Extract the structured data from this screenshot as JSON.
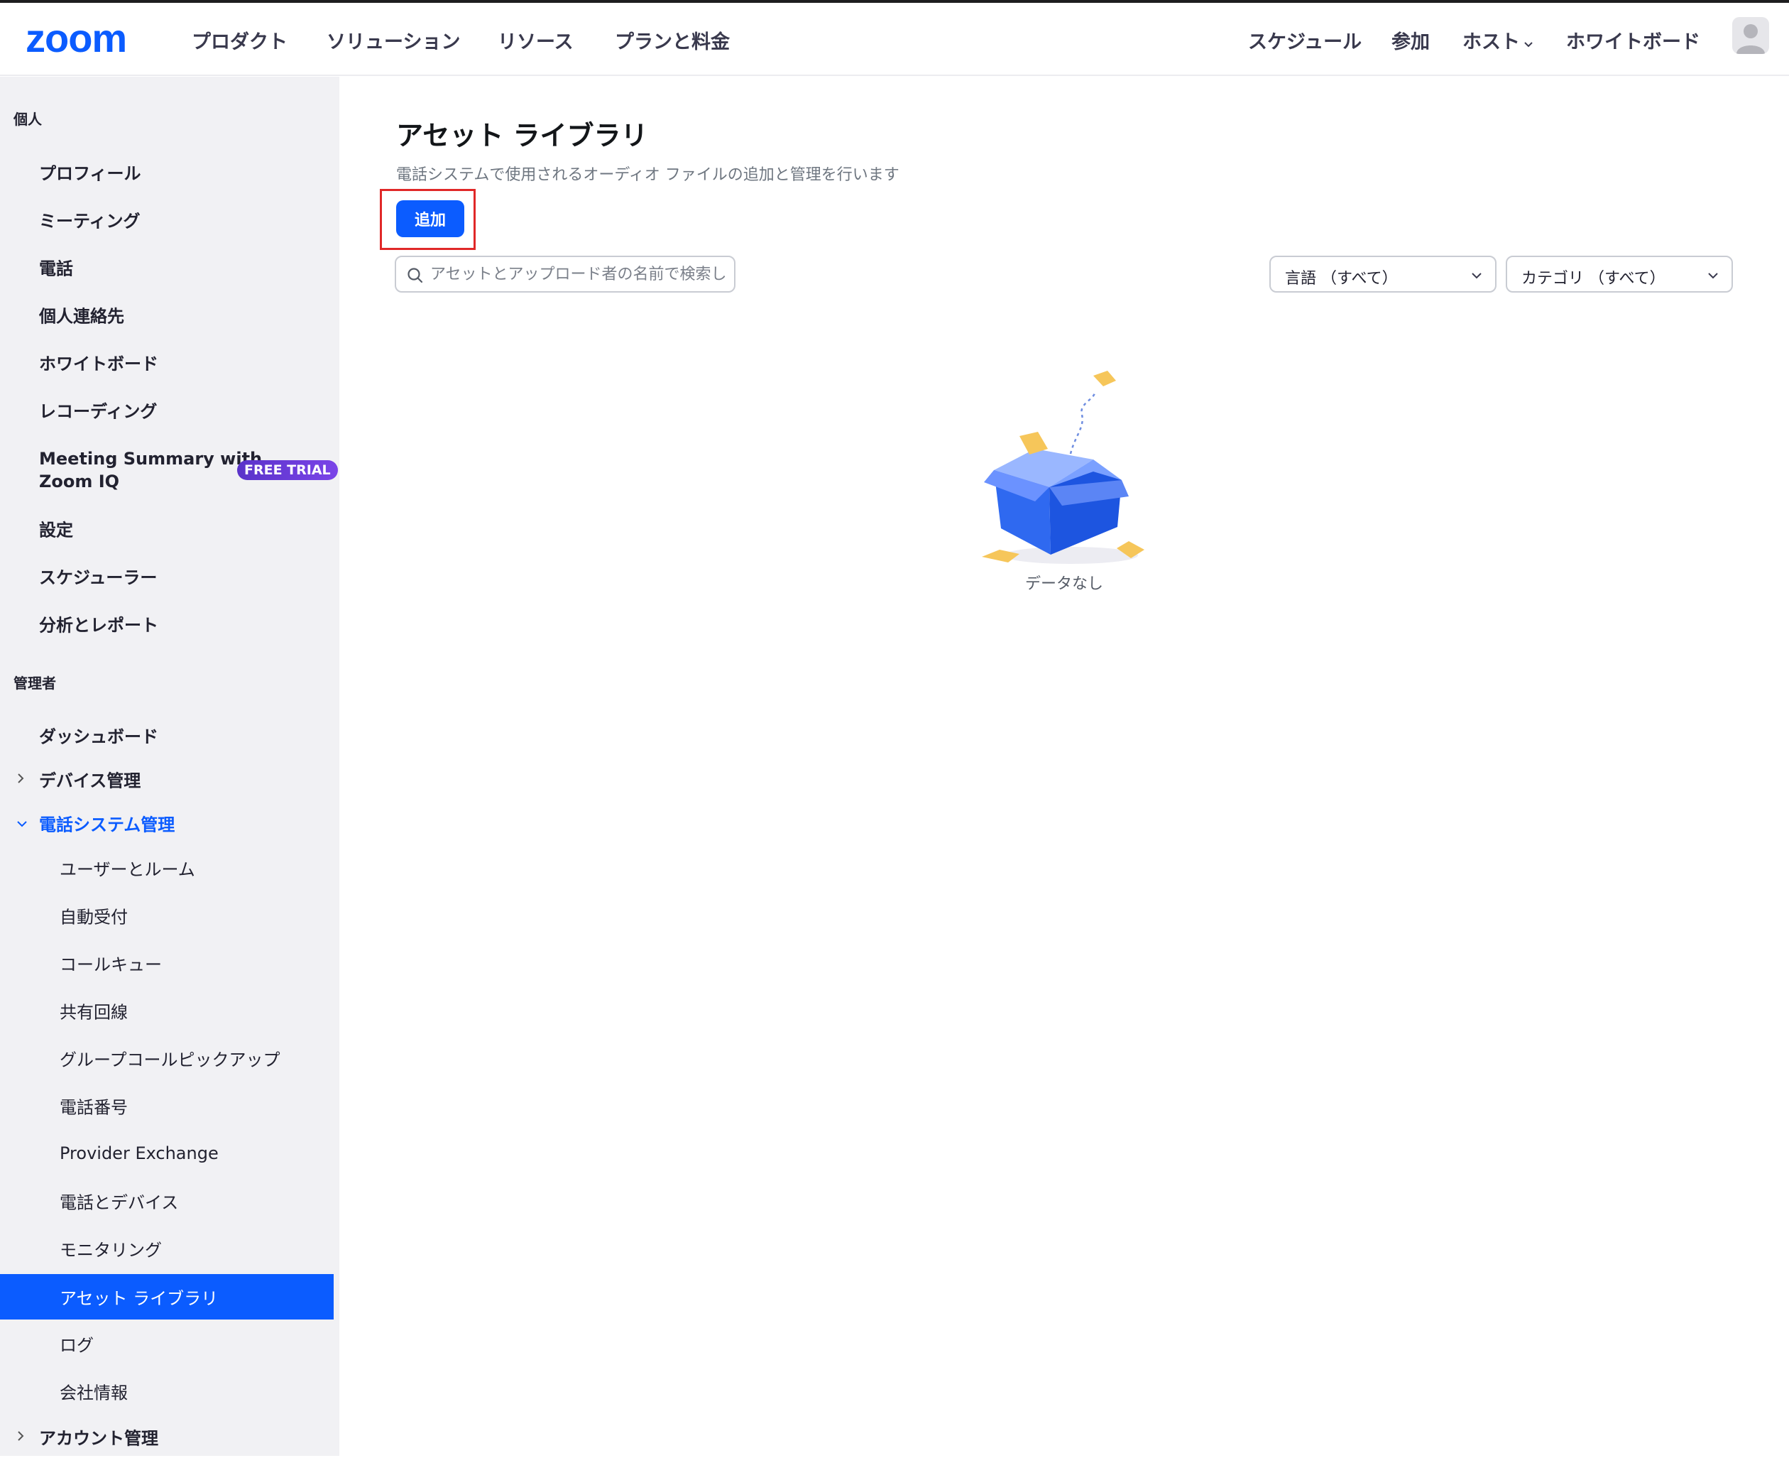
{
  "header": {
    "logo": "zoom",
    "nav": [
      "プロダクト",
      "ソリューション",
      "リソース",
      "プランと料金"
    ],
    "right_nav": {
      "schedule": "スケジュール",
      "join": "参加",
      "host": "ホスト",
      "whiteboard": "ホワイトボード"
    }
  },
  "sidebar": {
    "personal_heading": "個人",
    "personal_items": [
      "プロフィール",
      "ミーティング",
      "電話",
      "個人連絡先",
      "ホワイトボード",
      "レコーディング"
    ],
    "meeting_summary": {
      "line1": "Meeting Summary with",
      "line2": "Zoom IQ",
      "badge": "FREE TRIAL"
    },
    "personal_items_2": [
      "設定",
      "スケジューラー",
      "分析とレポート"
    ],
    "admin_heading": "管理者",
    "dashboard": "ダッシュボード",
    "device_mgmt": "デバイス管理",
    "phone_system_mgmt": "電話システム管理",
    "phone_sub_items": [
      "ユーザーとルーム",
      "自動受付",
      "コールキュー",
      "共有回線",
      "グループコールピックアップ",
      "電話番号",
      "Provider Exchange",
      "電話とデバイス",
      "モニタリング",
      "アセット ライブラリ",
      "ログ",
      "会社情報"
    ],
    "active_item": "アセット ライブラリ",
    "account_mgmt": "アカウント管理"
  },
  "main": {
    "title": "アセット ライブラリ",
    "description": "電話システムで使用されるオーディオ ファイルの追加と管理を行います",
    "add_button": "追加",
    "search_placeholder": "アセットとアップロード者の名前で検索し",
    "language_filter": "言語 （すべて）",
    "category_filter": "カテゴリ （すべて）",
    "empty_text": "データなし"
  },
  "colors": {
    "brand": "#0b5cff",
    "highlight": "#e02828",
    "sidebar_bg": "#f1f1f4"
  }
}
